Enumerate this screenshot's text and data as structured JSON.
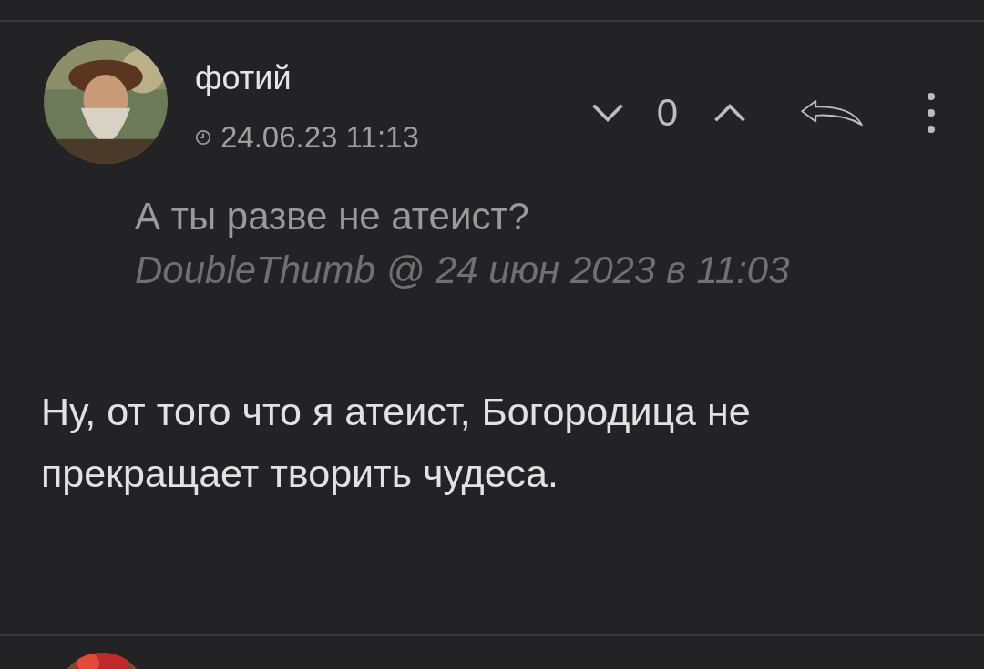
{
  "comment": {
    "author": "фотий",
    "date": "24.06.23 11:13",
    "votes": {
      "count": "0"
    },
    "quote": {
      "text": "А ты разве не атеист?",
      "attribution": "DoubleThumb @ 24 июн 2023 в 11:03"
    },
    "body": "Ну, от того что я атеист, Богородица не прекращает творить чудеса."
  }
}
